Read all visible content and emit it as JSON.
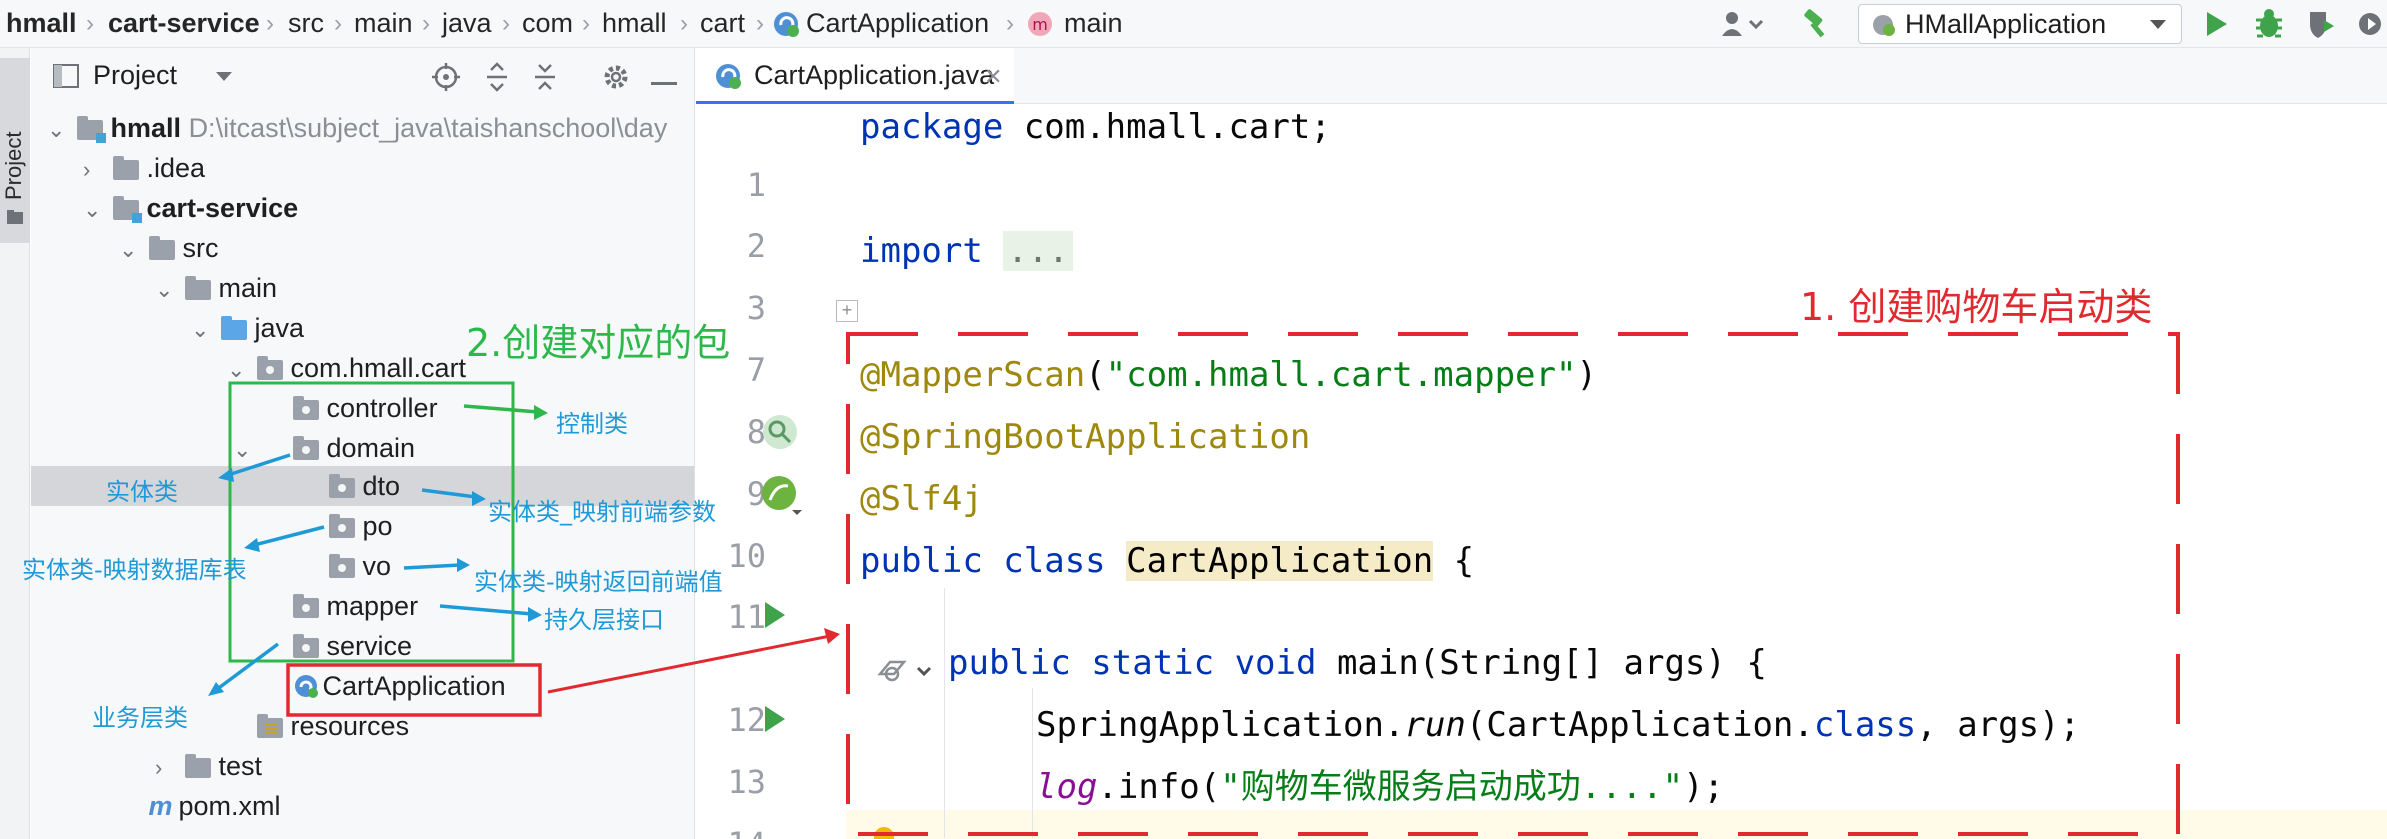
{
  "breadcrumb": {
    "items": [
      "hmall",
      "cart-service",
      "src",
      "main",
      "java",
      "com",
      "hmall",
      "cart",
      "CartApplication",
      "main"
    ]
  },
  "toolbar": {
    "run_config": "HMallApplication"
  },
  "left_strip": {
    "label": "Project"
  },
  "project_panel": {
    "title": "Project",
    "root_name": "hmall",
    "root_path": "D:\\itcast\\subject_java\\taishanschool\\day",
    "tree": [
      ".idea",
      "cart-service",
      "src",
      "main",
      "java",
      "com.hmall.cart",
      "controller",
      "domain",
      "dto",
      "po",
      "vo",
      "mapper",
      "service",
      "CartApplication",
      "resources",
      "test",
      "pom.xml"
    ]
  },
  "editor": {
    "tab_label": "CartApplication.java",
    "line_numbers": [
      "1",
      "2",
      "3",
      "7",
      "8",
      "9",
      "10",
      "11",
      "12",
      "13",
      "14"
    ],
    "code": {
      "l1_kw": "package",
      "l1_rest": " com.hmall.cart;",
      "l3_kw": "import",
      "l3_fold": "...",
      "l8_ann": "@MapperScan",
      "l8_str": "\"com.hmall.cart.mapper\"",
      "l9_ann": "@SpringBootApplication",
      "l10_ann": "@Slf4j",
      "l11_kw": "public class",
      "l11_cls": "CartApplication",
      "l11_rest": " {",
      "l12_kw": "public static void",
      "l12_rest": " main(String[] args) {",
      "l13_a": "SpringApplication.",
      "l13_run": "run",
      "l13_b": "(CartApplication.",
      "l13_kw": "class",
      "l13_c": ", args);",
      "l14_log": "log",
      "l14_a": ".info(",
      "l14_str": "\"购物车微服务启动成功....\"",
      "l14_b": ");"
    }
  },
  "annotations": {
    "create_package": "2.创建对应的包",
    "create_boot_class": "1. 创建购物车启动类",
    "controller_note": "控制类",
    "domain_note": "实体类",
    "dto_note": "实体类_映射前端参数",
    "po_note": "实体类-映射数据库表",
    "vo_note": "实体类-映射返回前端值",
    "mapper_note": "持久层接口",
    "service_note": "业务层类"
  },
  "colors": {
    "annotation_blue": "#1f9ad7",
    "annotation_green": "#2eb84b",
    "annotation_red": "#e02a2f",
    "keyword": "#0033b3",
    "annotation_code": "#9e880d",
    "string": "#067d17"
  }
}
